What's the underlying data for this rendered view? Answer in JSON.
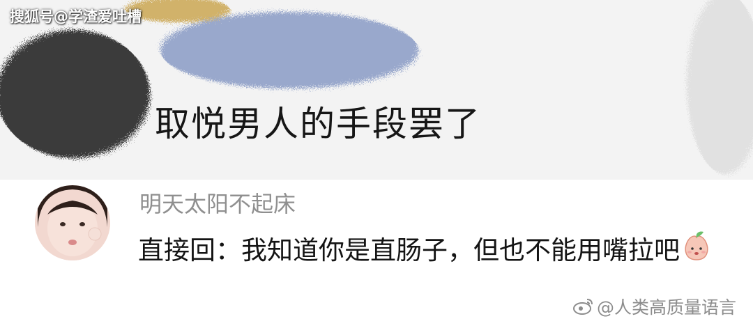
{
  "source_tag": "搜狐号@学渣爱吐槽",
  "post_snippet": "取悦男人的手段罢了",
  "comment": {
    "username": "明天太阳不起床",
    "text": "直接回：我知道你是直肠子，但也不能用嘴拉吧",
    "emoji": "peach-face-emoji"
  },
  "watermark": "@人类高质量语言",
  "colors": {
    "username": "#8f8f8f",
    "text": "#141414",
    "panel_bg": "#f3f3f3",
    "scribble_blue": "#7b8fc0",
    "scribble_black": "#1c1c1c",
    "scribble_gold": "#c9a24a"
  }
}
